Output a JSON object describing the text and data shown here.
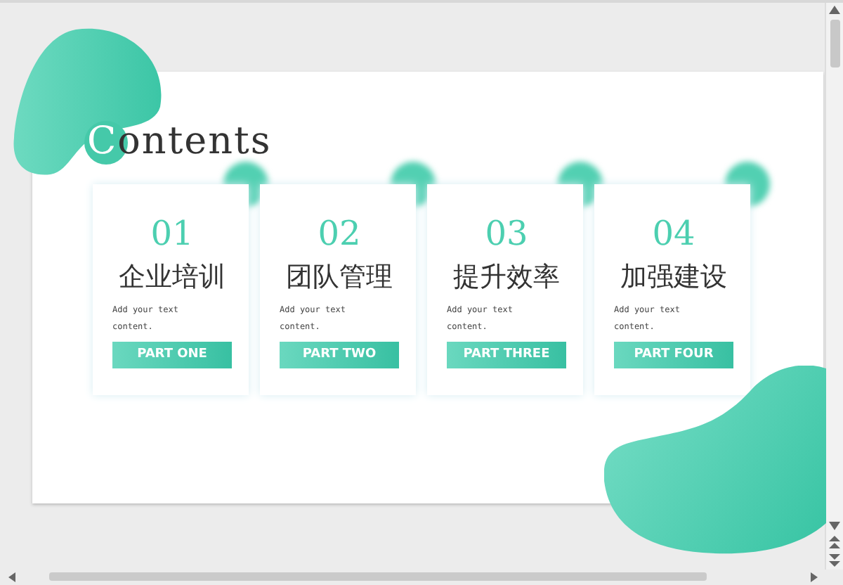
{
  "slide": {
    "title": {
      "initial": "C",
      "rest": "ontents"
    },
    "cards": [
      {
        "number": "01",
        "title": "企业培训",
        "text": "Add your text content.",
        "label": "PART ONE"
      },
      {
        "number": "02",
        "title": "团队管理",
        "text": "Add your text content.",
        "label": "PART TWO"
      },
      {
        "number": "03",
        "title": "提升效率",
        "text": "Add your text content.",
        "label": "PART THREE"
      },
      {
        "number": "04",
        "title": "加强建设",
        "text": "Add your text content.",
        "label": "PART FOUR"
      }
    ]
  }
}
